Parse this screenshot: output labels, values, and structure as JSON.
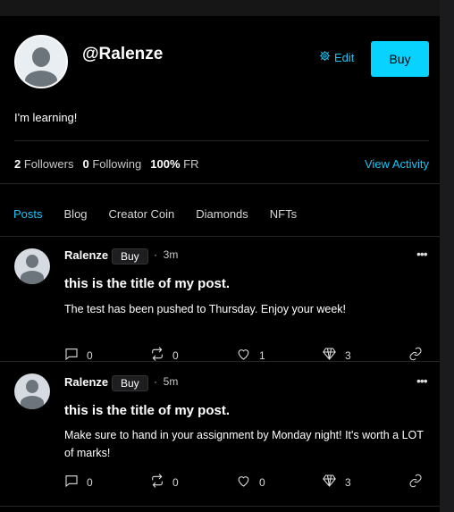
{
  "profile": {
    "username": "@Ralenze",
    "edit_label": "Edit",
    "buy_label": "Buy",
    "bio": "I'm learning!"
  },
  "stats": {
    "followers_count": "2",
    "followers_label": "Followers",
    "following_count": "0",
    "following_label": "Following",
    "fr_value": "100%",
    "fr_label": "FR",
    "view_activity": "View Activity"
  },
  "tabs": [
    {
      "label": "Posts",
      "active": true
    },
    {
      "label": "Blog"
    },
    {
      "label": "Creator Coin"
    },
    {
      "label": "Diamonds"
    },
    {
      "label": "NFTs"
    }
  ],
  "posts": [
    {
      "author": "Ralenze",
      "buy_label": "Buy",
      "time": "3m",
      "title": "this is the title of my post.",
      "body": "The test has been pushed to Thursday. Enjoy your week!",
      "comments": "0",
      "reposts": "0",
      "likes": "1",
      "diamonds": "3"
    },
    {
      "author": "Ralenze",
      "buy_label": "Buy",
      "time": "5m",
      "title": "this is the title of my post.",
      "body": "Make sure to hand in your assignment by Monday night! It's worth a LOT of marks!",
      "comments": "0",
      "reposts": "0",
      "likes": "0",
      "diamonds": "3"
    }
  ],
  "icons": {
    "edit": "gear-icon",
    "more": "more-icon",
    "comment": "comment-icon",
    "repost": "repost-icon",
    "like": "heart-icon",
    "diamond": "diamond-icon",
    "link": "link-icon"
  },
  "colors": {
    "accent": "#1cc4f4",
    "buy_button": "#08d3ff",
    "background": "#000000"
  }
}
